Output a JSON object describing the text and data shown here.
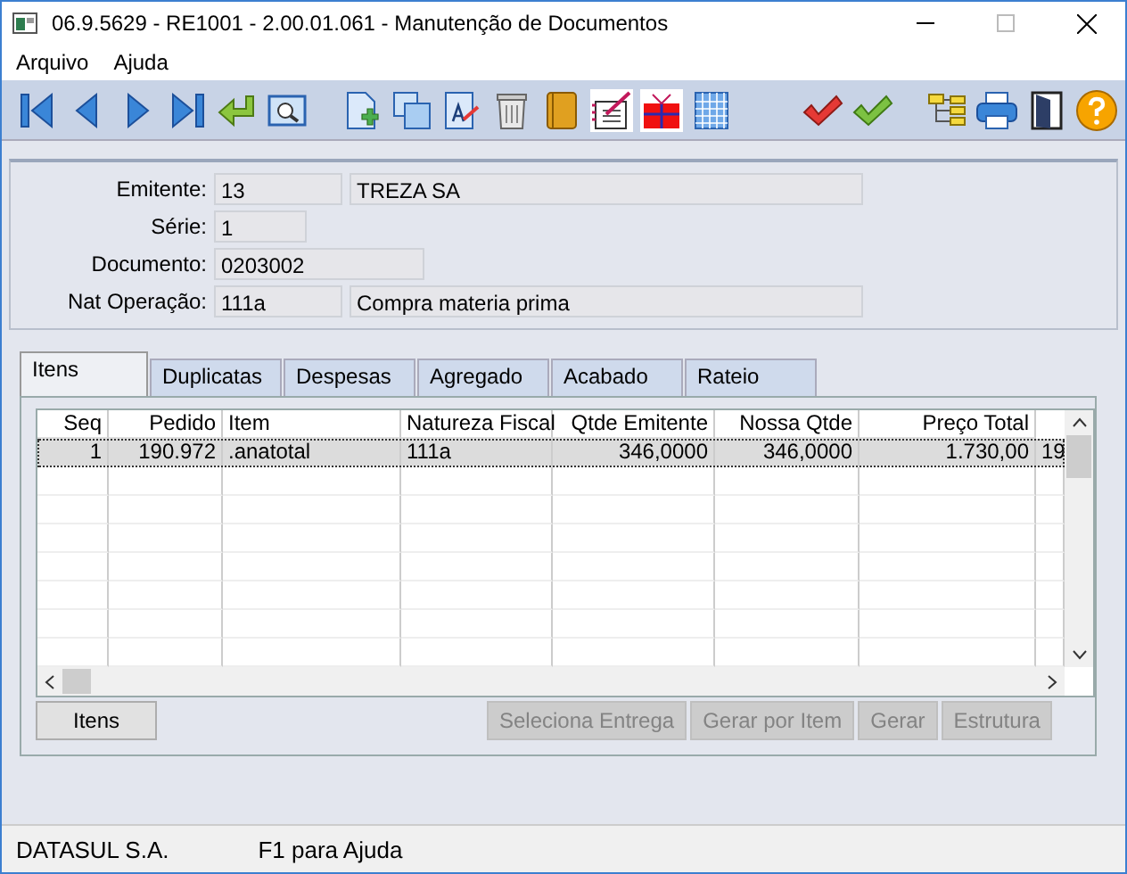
{
  "window": {
    "title": "06.9.5629 - RE1001 - 2.00.01.061 - Manutenção de Documentos"
  },
  "menu": [
    "Arquivo",
    "Ajuda"
  ],
  "toolbar": [
    {
      "kind": "first"
    },
    {
      "kind": "prev"
    },
    {
      "kind": "next"
    },
    {
      "kind": "last"
    },
    {
      "kind": "return"
    },
    {
      "kind": "zoom"
    },
    {
      "kind": "sep"
    },
    {
      "kind": "new"
    },
    {
      "kind": "copy"
    },
    {
      "kind": "edit"
    },
    {
      "kind": "delete"
    },
    {
      "kind": "book"
    },
    {
      "kind": "notebook"
    },
    {
      "kind": "gift"
    },
    {
      "kind": "calendar"
    },
    {
      "kind": "spacer"
    },
    {
      "kind": "check-red"
    },
    {
      "kind": "check-green"
    },
    {
      "kind": "sep"
    },
    {
      "kind": "tree"
    },
    {
      "kind": "print"
    },
    {
      "kind": "exit"
    },
    {
      "kind": "help"
    }
  ],
  "header": [
    {
      "label": "Emitente:",
      "code": "13",
      "description": "TREZA SA"
    },
    {
      "label": "Série:",
      "code": "1"
    },
    {
      "label": "Documento:",
      "code": "0203002"
    },
    {
      "label": "Nat Operação:",
      "code": "111a",
      "description": "Compra materia prima"
    }
  ],
  "tabs": [
    {
      "label": "Itens",
      "selected": true
    },
    {
      "label": "Duplicatas",
      "selected": false
    },
    {
      "label": "Despesas",
      "selected": false
    },
    {
      "label": "Agregado",
      "selected": false
    },
    {
      "label": "Acabado",
      "selected": false
    },
    {
      "label": "Rateio",
      "selected": false
    }
  ],
  "table": {
    "columns": [
      "Seq",
      "Pedido",
      "Item",
      "Natureza Fiscal",
      "Qtde Emitente",
      "Nossa Qtde",
      "Preço Total"
    ],
    "rows": [
      {
        "cells": [
          "1",
          "190.972",
          ".anatotal",
          "111a",
          "346,0000",
          "346,0000",
          "1.730,00",
          "19"
        ],
        "selected": true
      }
    ]
  },
  "buttons": [
    {
      "label": "Itens",
      "disabled": false
    },
    {
      "label": "Seleciona Entrega",
      "disabled": true
    },
    {
      "label": "Gerar por Item",
      "disabled": true
    },
    {
      "label": "Gerar",
      "disabled": true
    },
    {
      "label": "Estrutura",
      "disabled": true
    }
  ],
  "status_bar": [
    "DATASUL S.A.",
    "F1 para Ajuda"
  ]
}
